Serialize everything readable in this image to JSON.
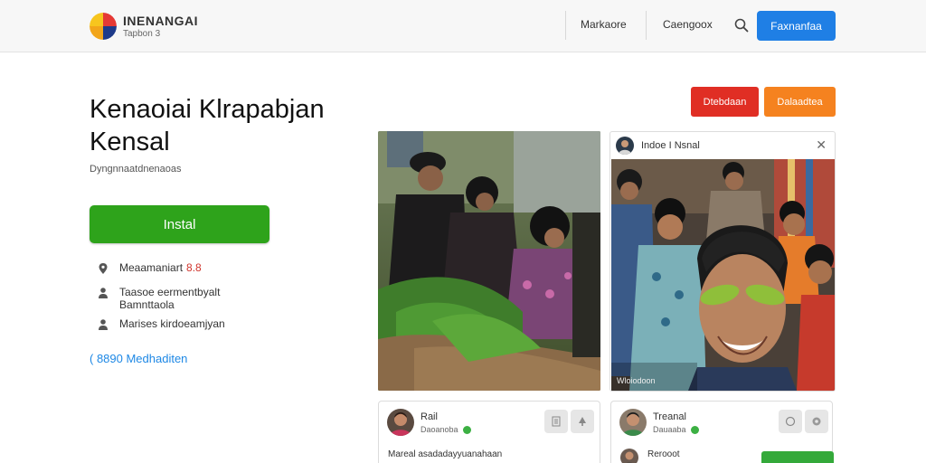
{
  "header": {
    "brand": "INENANGAI",
    "brand_sub": "Tapbon 3",
    "nav": [
      "Markaore",
      "Caengoox"
    ],
    "primary_button": "Faxnanfaa"
  },
  "app": {
    "title": "Kenaoiai Klrapabjan Kensal",
    "subtitle": "Dyngnnaatdnenaoas",
    "install_label": "Instal",
    "info": [
      {
        "icon": "location-icon",
        "text": "Meaamaniart",
        "badge": "8.8"
      },
      {
        "icon": "person-icon",
        "text": "Taasoe eermentbyalt Bamnttaola"
      },
      {
        "icon": "person-icon",
        "text": "Marises kirdoeamjyan"
      }
    ],
    "more_link": "( 8890 Medhaditen"
  },
  "actions": {
    "red_button": "Dtebdaan",
    "orange_button": "Dalaadtea"
  },
  "photo_card": {
    "header_text": "Indoe I Nsnal",
    "caption": "Wloiodoon"
  },
  "bottom_cards": [
    {
      "name": "Rail",
      "meta": "Daoanoba",
      "bottom": "Mareal asadadayyuanahaan"
    },
    {
      "name": "Treanal",
      "meta": "Dauaaba",
      "bottom": "Rerooot"
    }
  ],
  "colors": {
    "primary": "#1f7fe5",
    "install": "#2ea31b",
    "red": "#e02e24",
    "orange": "#f5821f",
    "link": "#1e88e5"
  }
}
